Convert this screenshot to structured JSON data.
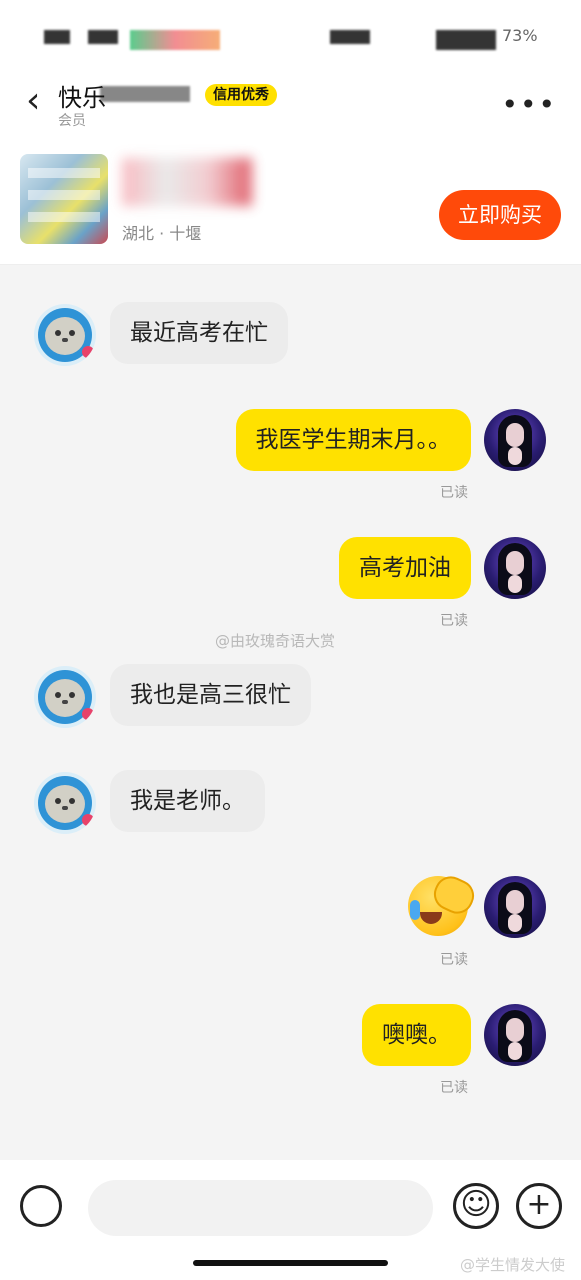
{
  "status_bar": {
    "battery": "73%"
  },
  "header": {
    "back_glyph": "‹",
    "title": "快乐",
    "badge": "信用优秀",
    "subtitle": "会员",
    "more_glyph": "•••"
  },
  "product": {
    "location": "湖北 · 十堰",
    "buy_label": "立即购买"
  },
  "messages": [
    {
      "side": "left",
      "text": "最近高考在忙"
    },
    {
      "side": "right",
      "text": "我医学生期末月。。",
      "status": "已读"
    },
    {
      "side": "right",
      "text": "高考加油",
      "status": "已读"
    },
    {
      "side": "left",
      "text": "我也是高三很忙"
    },
    {
      "side": "left",
      "text": "我是老师。"
    },
    {
      "side": "right",
      "emoji": "face-palm-crying-emoji",
      "status": "已读"
    },
    {
      "side": "right",
      "text": "噢噢。",
      "status": "已读"
    }
  ],
  "watermarks": {
    "middle": "@由玫瑰奇语大赏",
    "bottom": "@学生情发大使"
  },
  "input_bar": {
    "placeholder": "",
    "emoji_glyph": "☺",
    "plus_glyph": "+"
  },
  "colors": {
    "accent_yellow": "#ffe100",
    "buy_orange": "#ff4a0a",
    "bubble_gray": "#ececec"
  }
}
